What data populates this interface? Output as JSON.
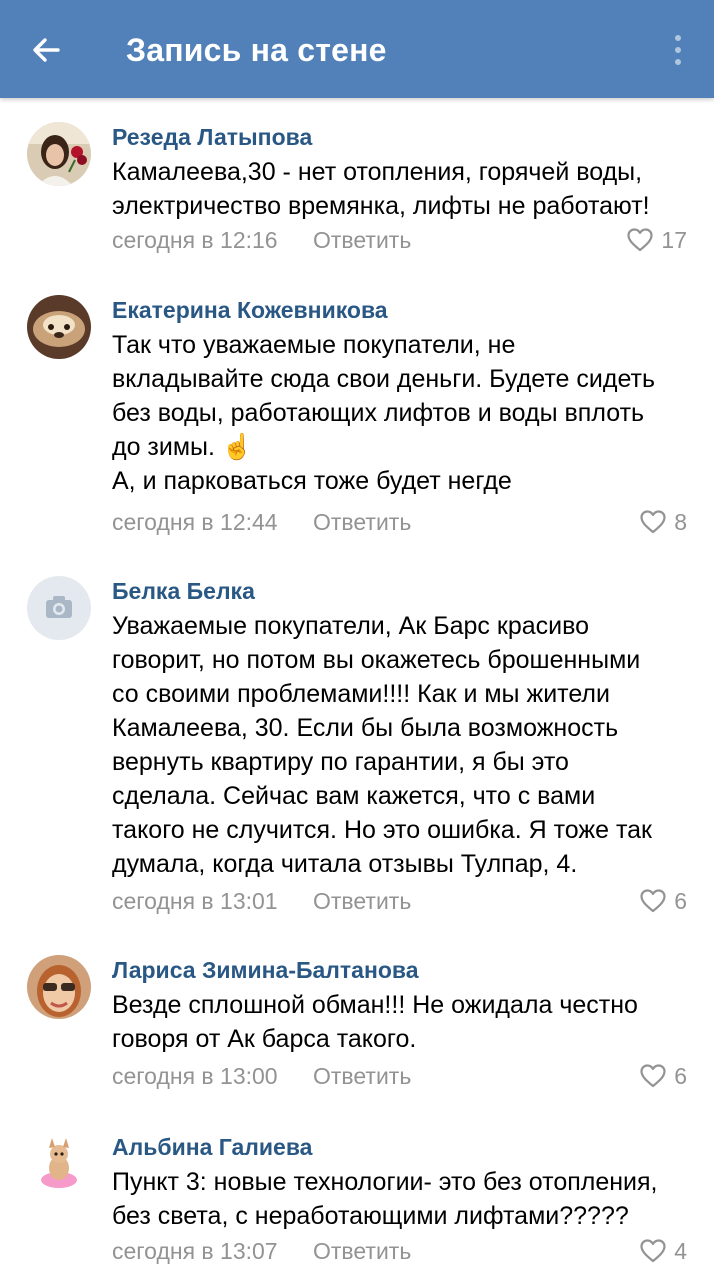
{
  "header": {
    "title": "Запись на стене",
    "back_icon": "arrow-left-icon",
    "menu_icon": "more-vertical-icon",
    "background": "#5181b8"
  },
  "colors": {
    "author": "#2a5885",
    "meta": "#939393",
    "accent": "#5181b8"
  },
  "comments": [
    {
      "author": "Резеда Латыпова",
      "text": "Камалеева,30 - нет отопления, горячей воды,\nэлектричество времянка, лифты не работают!",
      "time": "сегодня в 12:16",
      "reply": "Ответить",
      "likes": "17"
    },
    {
      "author": "Екатерина Кожевникова",
      "text": "Так что уважаемые покупатели, не\nвкладывайте сюда свои деньги. Будете сидеть\nбез воды, работающих лифтов и воды вплоть\nдо зимы. ☝️\nА, и парковаться тоже будет негде",
      "time": "сегодня в 12:44",
      "reply": "Ответить",
      "likes": "8"
    },
    {
      "author": "Белка Белка",
      "text": "Уважаемые покупатели, Ак Барс красиво\nговорит, но потом вы окажетесь брошенными\nсо своими проблемами!!!! Как и мы жители\nКамалеева, 30. Если бы была возможность\nвернуть квартиру по гарантии, я бы  это\nсделала. Сейчас вам кажется, что с вами\nтакого не случится. Но это ошибка. Я тоже так\nдумала, когда читала отзывы Тулпар, 4.",
      "time": "сегодня в 13:01",
      "reply": "Ответить",
      "likes": "6"
    },
    {
      "author": "Лариса Зимина-Балтанова",
      "text": "Везде сплошной обман!!! Не ожидала честно\nговоря от Ак барса такого.",
      "time": "сегодня в 13:00",
      "reply": "Ответить",
      "likes": "6"
    },
    {
      "author": "Альбина Галиева",
      "text": "Пункт 3: новые технологии- это без отопления,\nбез света, с неработающими лифтами?????",
      "time": "сегодня в 13:07",
      "reply": "Ответить",
      "likes": "4"
    }
  ]
}
